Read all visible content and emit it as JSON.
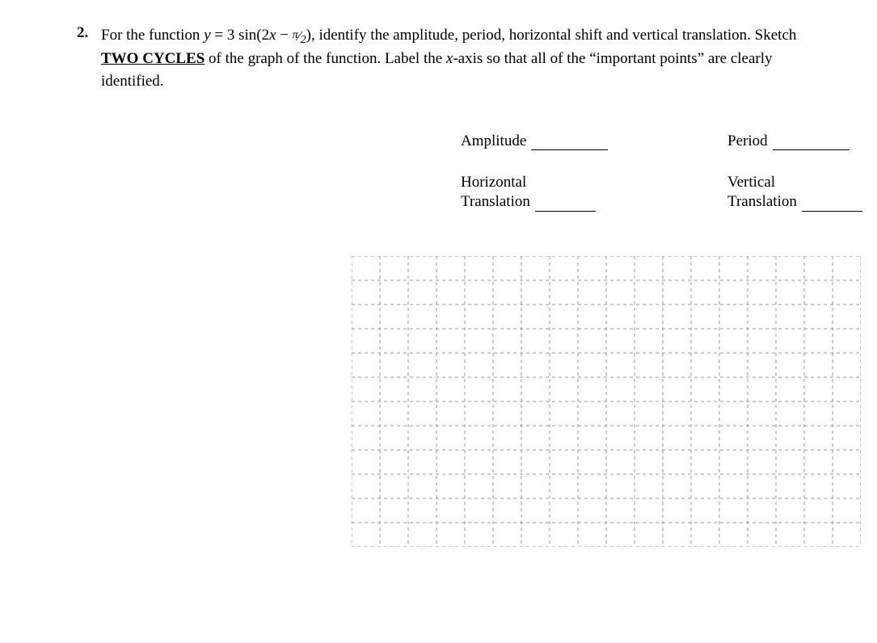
{
  "question_number": "2.",
  "question_text_part1": "For the function ",
  "question_equation": "y = 3 sin(2x − π⁄2)",
  "question_text_part2": ", identify the amplitude, period, horizontal shift and vertical translation. Sketch ",
  "two_cycles": "TWO CYCLES",
  "question_text_part3": " of the graph of the function. Label the ",
  "xaxis": "x",
  "question_text_part4": "-axis so that all of the “important points” are clearly identified.",
  "labels": {
    "amplitude": "Amplitude",
    "period": "Period",
    "horiz1": "Horizontal",
    "horiz2": "Translation",
    "vert1": "Vertical",
    "vert2": "Translation"
  }
}
